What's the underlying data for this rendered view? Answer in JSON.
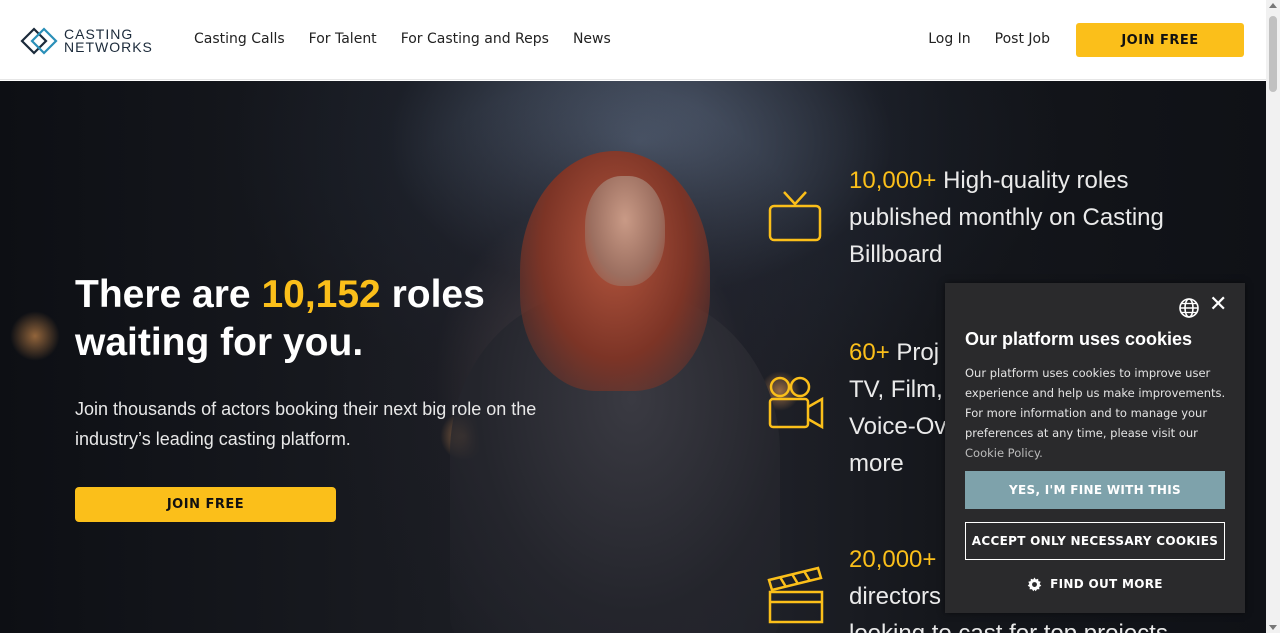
{
  "header": {
    "logo": {
      "line1": "CASTING",
      "line2": "NETWORKS"
    },
    "nav": [
      {
        "label": "Casting Calls"
      },
      {
        "label": "For Talent"
      },
      {
        "label": "For Casting and Reps"
      },
      {
        "label": "News"
      }
    ],
    "login_label": "Log In",
    "post_job_label": "Post Job",
    "join_label": "JOIN FREE"
  },
  "hero": {
    "title_prefix": "There are ",
    "title_number": "10,152",
    "title_suffix": " roles waiting for you.",
    "subtitle": "Join thousands of actors booking their next big role on the industry’s leading casting platform.",
    "join_label": "JOIN FREE",
    "features": [
      {
        "icon": "tv-icon",
        "number": "10,000+",
        "text": " High-quality roles published monthly on Casting Billboard"
      },
      {
        "icon": "video-camera-icon",
        "number": "60+",
        "text": " Proj… TV, Film, … Voice-Ov… more"
      },
      {
        "icon": "clapperboard-icon",
        "number": "20,000+",
        "text": " … directors … looking to cast for top projects"
      }
    ],
    "feature2_lines": [
      "60+",
      " Proj",
      "TV, Film, ",
      "Voice-Ov",
      "more"
    ],
    "feature3_lines": [
      "20,000+",
      "directors",
      "looking to cast for top projects"
    ]
  },
  "cookie": {
    "title": "Our platform uses cookies",
    "text": "Our platform uses cookies to improve user experience and help us make improvements. For more information and to manage your preferences at any time, please visit our ",
    "link_label": "Cookie Policy.",
    "accept_label": "YES, I'M FINE WITH THIS",
    "necessary_label": "ACCEPT ONLY NECESSARY COOKIES",
    "more_label": "FIND OUT MORE",
    "close_symbol": "✕"
  },
  "colors": {
    "accent": "#fbbf1a",
    "cookie_bg": "#2a2a2c",
    "cookie_accept": "#7ea2ab"
  }
}
